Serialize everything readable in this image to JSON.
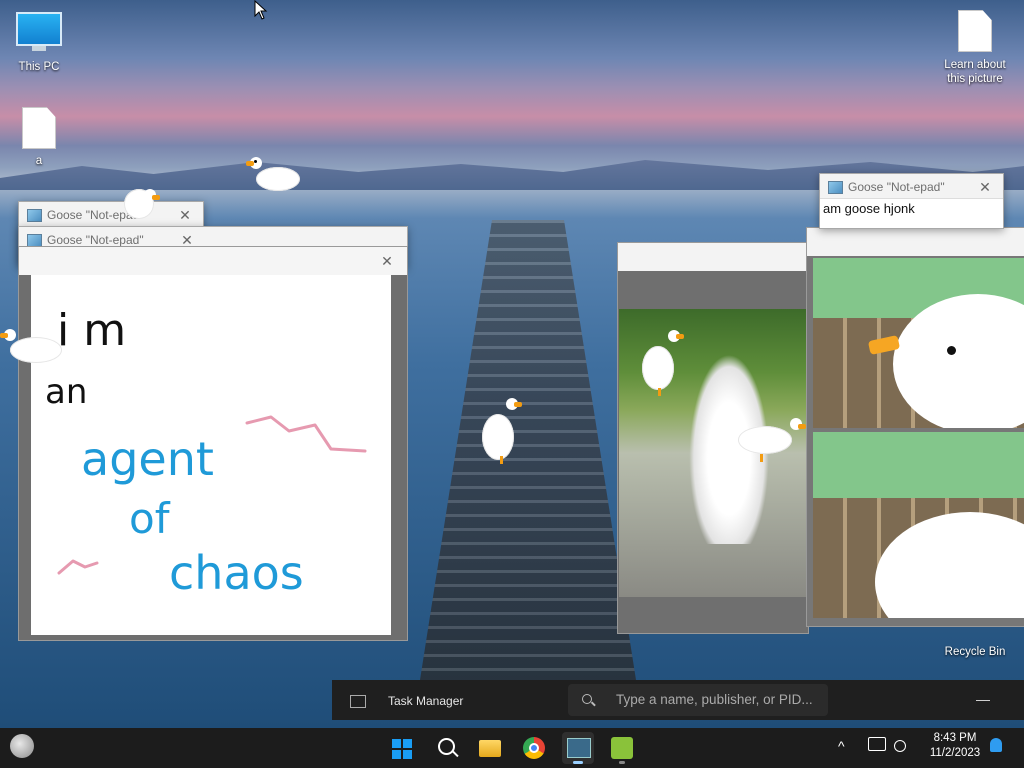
{
  "desktop": {
    "icons": [
      {
        "label": "This PC"
      },
      {
        "label": "a"
      },
      {
        "label": "Learn about this picture"
      },
      {
        "label": "Recycle Bin"
      }
    ]
  },
  "notepads": [
    {
      "title": "Goose \"Not-epad\"",
      "close": "✕"
    },
    {
      "title": "Goose \"Not-epad\"",
      "close": "✕"
    },
    {
      "title": "Goose \"Not-epad\"",
      "close": "✕",
      "text": "am goose hjonk"
    }
  ],
  "drawing": {
    "close": "✕",
    "lines": [
      "i m",
      "an",
      "agent",
      "of",
      "chaos"
    ]
  },
  "task_manager": {
    "title": "Task Manager",
    "search_placeholder": "Type a name, publisher, or PID...",
    "minimize": "—"
  },
  "taskbar": {
    "time": "8:43 PM",
    "date": "11/2/2023",
    "chevron": "^"
  },
  "colors": {
    "taskbar": "#1c1c1c",
    "accent": "#1a9ef5",
    "scribble_blue": "#1f9ad8",
    "scribble_pink": "#e69ab0"
  }
}
